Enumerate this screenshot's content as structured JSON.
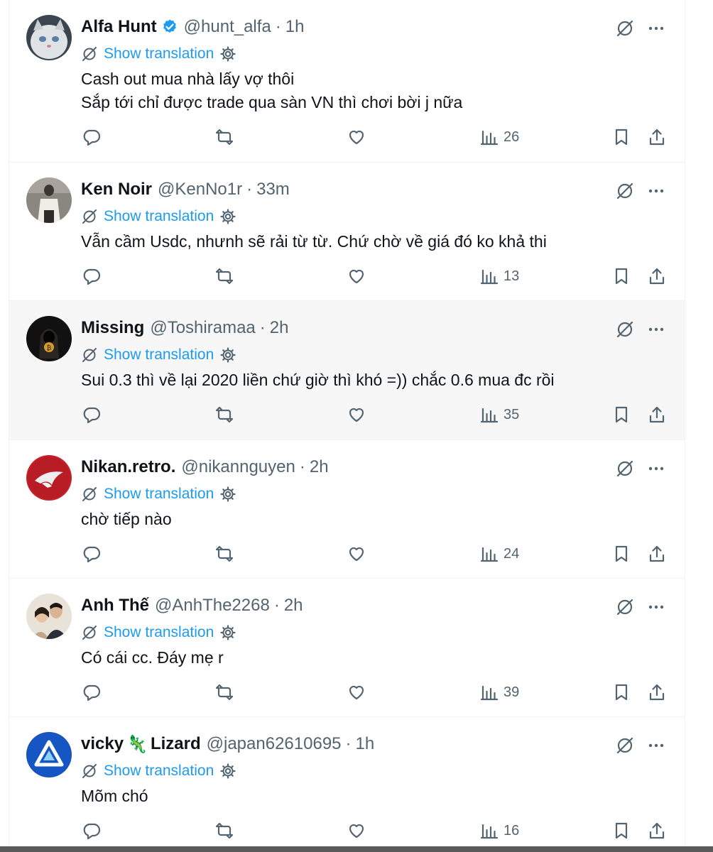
{
  "common": {
    "show_translation": "Show translation",
    "separator": "·"
  },
  "tweets": [
    {
      "name": "Alfa Hunt",
      "verified": true,
      "handle": "@hunt_alfa",
      "time": "1h",
      "lines": [
        "Cash out mua nhà lấy vợ thôi",
        "Sắp tới chỉ được trade qua sàn VN thì chơi bời j nữa"
      ],
      "views": "26",
      "avatar_icon": "cat-avatar"
    },
    {
      "name": "Ken Noir",
      "verified": false,
      "handle": "@KenNo1r",
      "time": "33m",
      "lines": [
        "Vẫn cầm Usdc, nhưnh sẽ rải từ từ. Chứ chờ về giá đó ko khả thi"
      ],
      "views": "13",
      "avatar_icon": "person-avatar"
    },
    {
      "name": "Missing",
      "verified": false,
      "handle": "@Toshiramaa",
      "time": "2h",
      "lines": [
        "Sui 0.3 thì về lại 2020 liền chứ giờ thì khó =)) chắc 0.6 mua đc rồi"
      ],
      "views": "35",
      "avatar_icon": "hooded-figure-avatar"
    },
    {
      "name": "Nikan.retro.",
      "verified": false,
      "handle": "@nikannguyen",
      "time": "2h",
      "lines": [
        "chờ tiếp nào"
      ],
      "views": "24",
      "avatar_icon": "rog-logo-avatar"
    },
    {
      "name": "Anh Thế",
      "verified": false,
      "handle": "@AnhThe2268",
      "time": "2h",
      "lines": [
        "Có cái cc. Đáy mẹ r"
      ],
      "views": "39",
      "avatar_icon": "couple-photo-avatar"
    },
    {
      "name": "vicky",
      "name_suffix": "Lizard",
      "emoji": "🦎",
      "verified": false,
      "handle": "@japan62610695",
      "time": "1h",
      "lines": [
        "Mõm chó"
      ],
      "views": "16",
      "avatar_icon": "triangle-logo-avatar"
    }
  ],
  "colors": {
    "link_blue": "#1d9bf0",
    "muted_gray": "#536471",
    "text_dark": "#0f1419",
    "highlight_row": "#f7f7f7"
  }
}
